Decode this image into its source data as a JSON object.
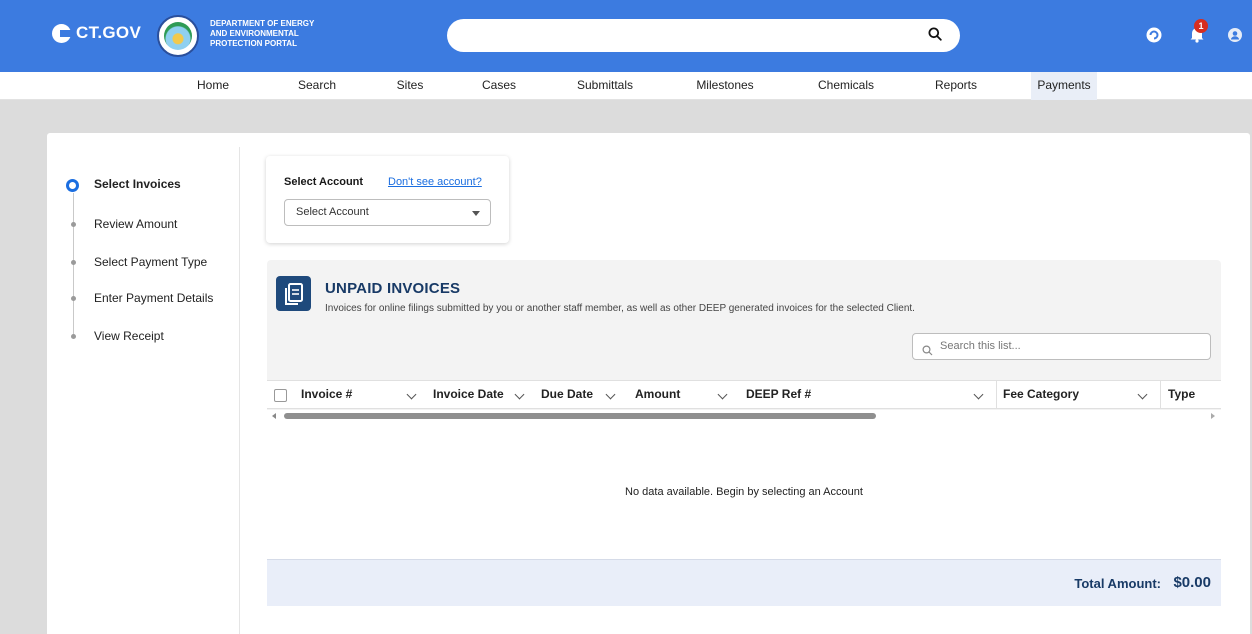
{
  "header": {
    "brand": "CT.GOV",
    "department_line1": "DEPARTMENT OF ENERGY",
    "department_line2": "AND ENVIRONMENTAL",
    "department_line3": "PROTECTION PORTAL",
    "search_value": "",
    "notification_count": "1"
  },
  "nav": {
    "items": [
      "Home",
      "Search",
      "Sites",
      "Cases",
      "Submittals",
      "Milestones",
      "Chemicals",
      "Reports",
      "Payments"
    ],
    "active": "Payments"
  },
  "steps": {
    "items": [
      "Select Invoices",
      "Review Amount",
      "Select Payment Type",
      "Enter Payment Details",
      "View Receipt"
    ],
    "current": "Select Invoices"
  },
  "account": {
    "label": "Select Account",
    "link": "Don't see account?",
    "select_value": "Select Account"
  },
  "invoices": {
    "title": "UNPAID INVOICES",
    "description": "Invoices for online filings submitted by you or another staff member, as well as other DEEP generated invoices for the selected Client.",
    "search_placeholder": "Search this list...",
    "columns": [
      "Invoice #",
      "Invoice Date",
      "Due Date",
      "Amount",
      "DEEP Ref #",
      "Fee Category",
      "Type"
    ],
    "empty_message": "No data available. Begin by selecting an Account",
    "total_label": "Total Amount:",
    "total_value": "$0.00"
  },
  "colors": {
    "header_blue": "#3c7be0",
    "navy": "#183a66",
    "link_blue": "#1b6ee0",
    "badge_red": "#d62d20"
  },
  "icons": [
    "ct-logo-icon",
    "state-seal-icon",
    "search-icon",
    "help-icon",
    "bell-icon",
    "user-icon",
    "document-icon",
    "chevron-down-icon"
  ]
}
